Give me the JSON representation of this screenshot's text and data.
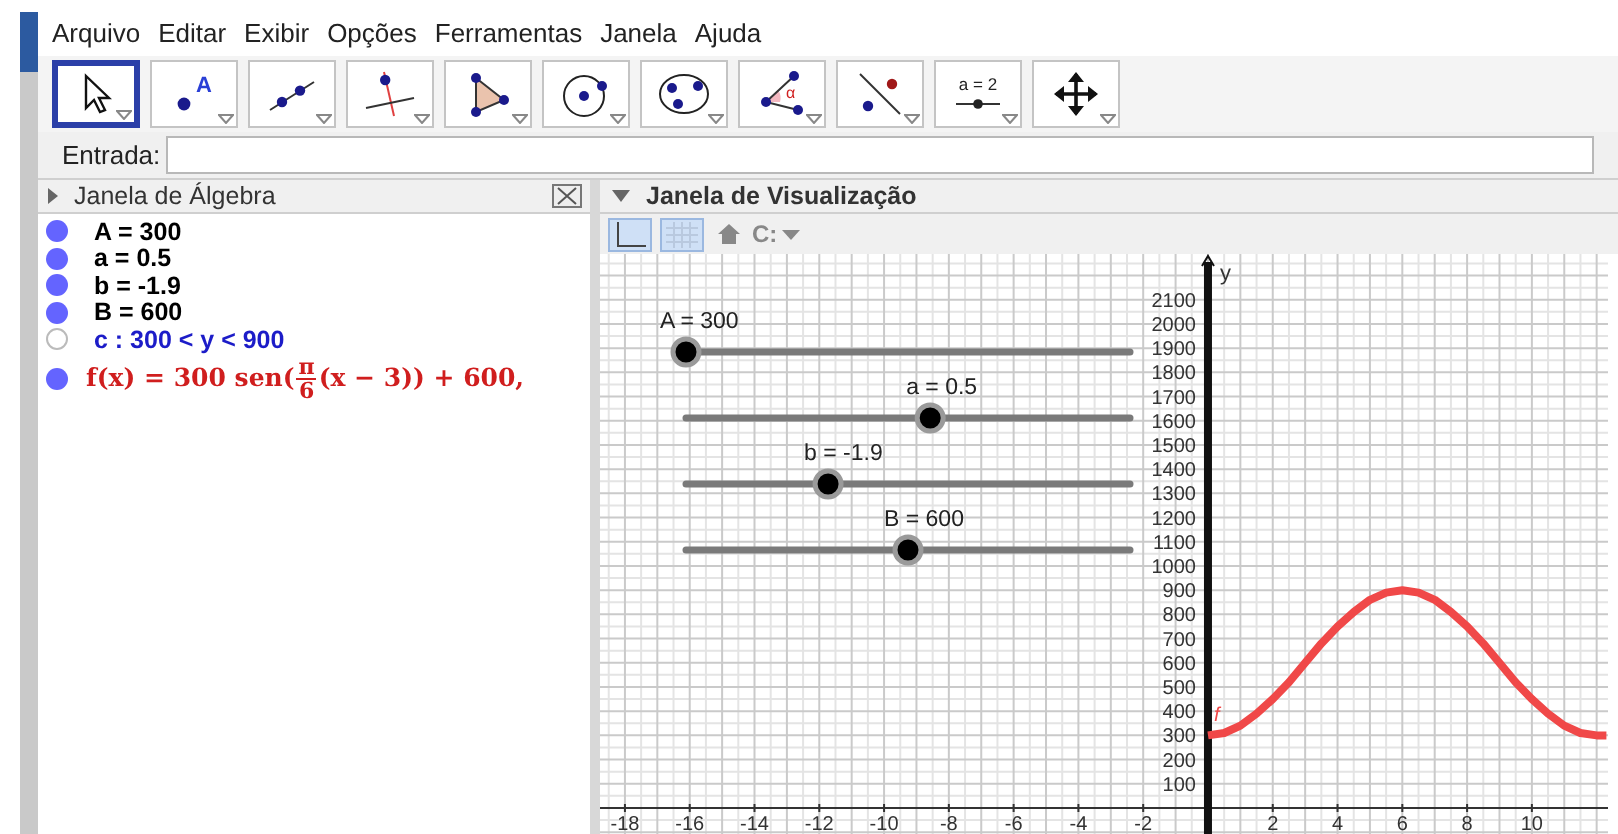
{
  "menu": [
    "Arquivo",
    "Editar",
    "Exibir",
    "Opções",
    "Ferramentas",
    "Janela",
    "Ajuda"
  ],
  "tools": [
    {
      "kind": "move",
      "selected": true
    },
    {
      "kind": "point",
      "label": "A",
      "selected": false
    },
    {
      "kind": "line",
      "selected": false
    },
    {
      "kind": "perpendicular",
      "selected": false
    },
    {
      "kind": "polygon",
      "selected": false
    },
    {
      "kind": "circle",
      "selected": false
    },
    {
      "kind": "conic",
      "selected": false
    },
    {
      "kind": "angle",
      "label": "α",
      "selected": false
    },
    {
      "kind": "reflect",
      "selected": false
    },
    {
      "kind": "slider",
      "label": "a = 2",
      "selected": false
    },
    {
      "kind": "move-view",
      "selected": false
    }
  ],
  "input_bar": {
    "label": "Entrada:"
  },
  "algebra_view": {
    "title": "Janela de Álgebra",
    "items": [
      {
        "kind": "text",
        "text": "A = 300",
        "visible": true,
        "color": "#000000"
      },
      {
        "kind": "text",
        "text": "a = 0.5",
        "visible": true,
        "color": "#000000"
      },
      {
        "kind": "text",
        "text": "b = -1.9",
        "visible": true,
        "color": "#000000"
      },
      {
        "kind": "text",
        "text": "B = 600",
        "visible": true,
        "color": "#000000"
      },
      {
        "kind": "text",
        "text": "c : 300 < y < 900",
        "visible": false,
        "color": "#1c1cc8"
      },
      {
        "kind": "formula",
        "prefix": "f(x) = 300 sen(",
        "numerator": "π",
        "denominator": "6",
        "suffix": " (x − 3)) + 600,",
        "visible": true,
        "color": "#d01e1e"
      }
    ]
  },
  "graphics_view": {
    "title": "Janela de Visualização",
    "axes_on": true,
    "grid_on": true,
    "style_label": "C:",
    "sliders": [
      {
        "label": "A = 300",
        "level": 0
      },
      {
        "label": "a = 0.5",
        "level": 0.55
      },
      {
        "label": "b = -1.9",
        "level": 0.32
      },
      {
        "label": "B = 600",
        "level": 0.5
      }
    ],
    "y_axis_label": "y",
    "chart_data": {
      "type": "line",
      "x": [
        0,
        0.5,
        1,
        1.5,
        2,
        2.5,
        3,
        3.5,
        4,
        4.5,
        5,
        5.5,
        6,
        6.5,
        7,
        7.5,
        8,
        8.5,
        9,
        9.5,
        10,
        10.5,
        11,
        11.5,
        12,
        12.3
      ],
      "series": [
        {
          "name": "f",
          "color": "#f04848",
          "values": [
            300,
            310,
            340,
            390,
            450,
            520,
            600,
            680,
            750,
            810,
            860,
            890,
            900,
            890,
            860,
            810,
            750,
            680,
            600,
            520,
            450,
            390,
            340,
            310,
            300,
            300
          ]
        }
      ],
      "xlim": [
        -18.77,
        12.35
      ],
      "ylim": [
        -149,
        2289
      ],
      "grid": true,
      "xticks": [
        -18,
        -16,
        -14,
        -12,
        -10,
        -8,
        -6,
        -4,
        -2,
        2,
        4,
        6,
        8,
        10
      ],
      "yticks": [
        100,
        200,
        300,
        400,
        500,
        600,
        700,
        800,
        900,
        1000,
        1100,
        1200,
        1300,
        1400,
        1500,
        1600,
        1700,
        1800,
        1900,
        2000,
        2100
      ]
    }
  }
}
